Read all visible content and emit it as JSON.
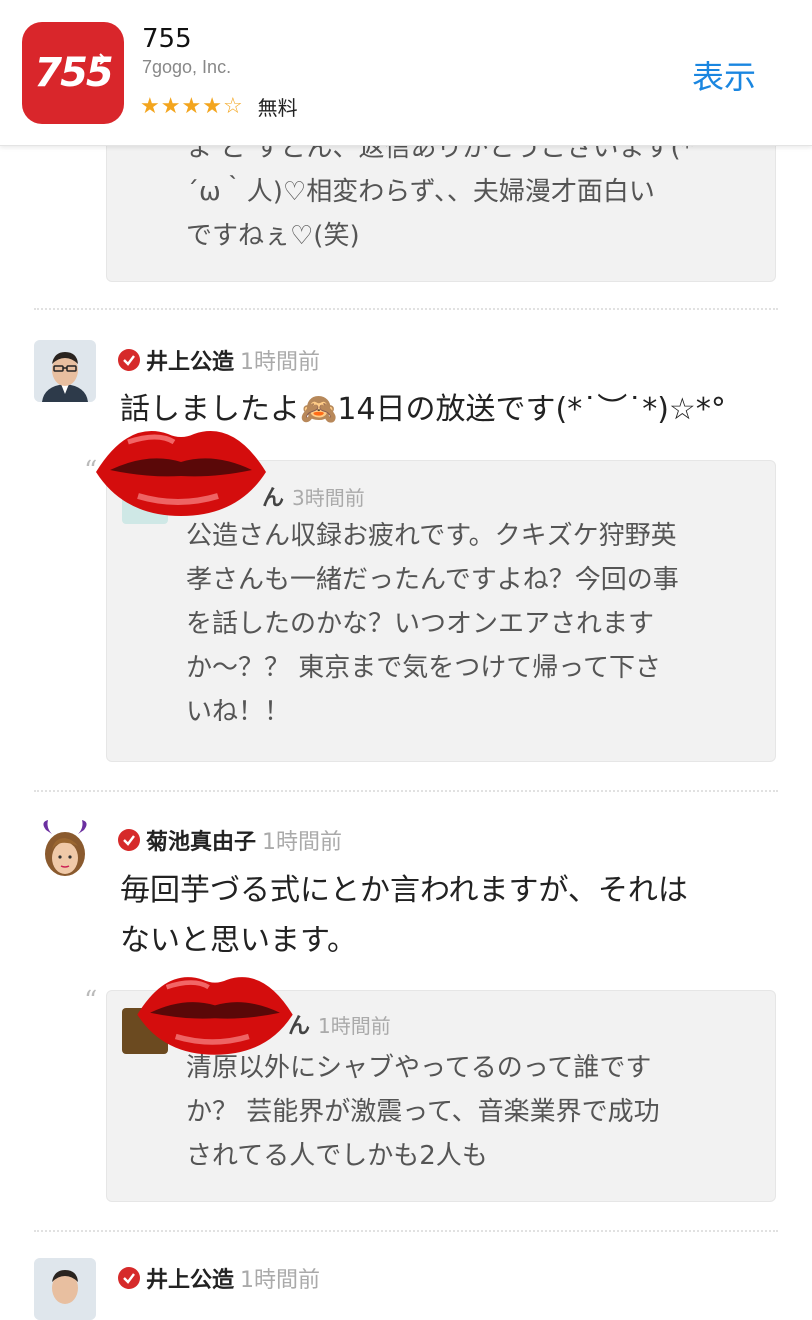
{
  "banner": {
    "icon_text": "755",
    "name": "755",
    "developer": "7gogo, Inc.",
    "stars": [
      1,
      1,
      1,
      1,
      0
    ],
    "price": "無料",
    "open_label": "表示"
  },
  "posts": [
    {
      "quote_text_top": "ま ど すどん、返信ありがとうございます(*\n´ω｀人)♡相変わらず、、夫婦漫才面白い\nですねぇ♡(笑)"
    },
    {
      "name": "井上公造",
      "time": "1時間前",
      "body": "話しましたよ🙈14日の放送です(*˙︶˙*)☆*°",
      "quote": {
        "name_suffix": "ん",
        "time": "3時間前",
        "text": "公造さん収録お疲れです。クキズケ狩野英\n孝さんも一緒だったんですよね？今回の事\nを話したのかな？いつオンエアされます\nか～？？ 東京まで気をつけて帰って下さ\nいね！！"
      }
    },
    {
      "name": "菊池真由子",
      "time": "1時間前",
      "body": "毎回芋づる式にとか言われますが、それは\nないと思います。",
      "quote": {
        "name_suffix": "ん",
        "time": "1時間前",
        "text": "清原以外にシャブやってるのって誰です\nか？ 芸能界が激震って、音楽業界で成功\nされてる人でしかも2人も"
      }
    },
    {
      "name": "井上公造",
      "time": "1時間前"
    }
  ],
  "quote_mark": "“"
}
